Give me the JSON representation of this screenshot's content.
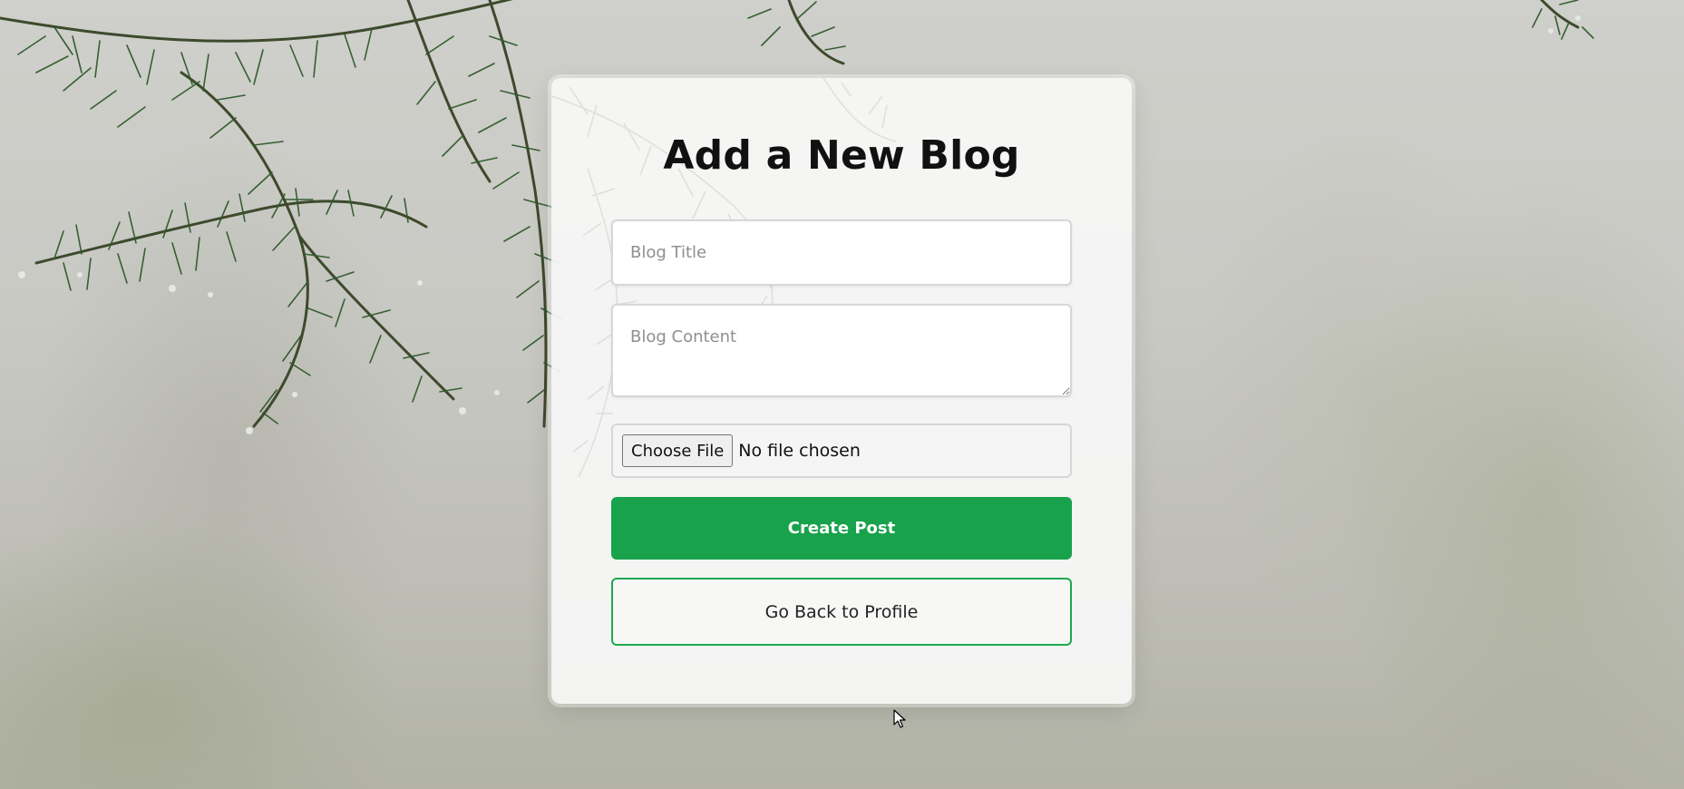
{
  "page": {
    "heading": "Add a New Blog"
  },
  "form": {
    "title_placeholder": "Blog Title",
    "title_value": "",
    "content_placeholder": "Blog Content",
    "content_value": "",
    "file_button_label": "Choose File",
    "file_status": "No file chosen",
    "create_label": "Create Post",
    "back_label": "Go Back to Profile"
  },
  "colors": {
    "primary_green": "#18a24b",
    "outline_green": "#1fa84f",
    "card_background": "#f8f8f7",
    "heading_text": "#111111"
  },
  "icons": {
    "cursor": "mouse-pointer-icon",
    "resize": "resize-handle-icon"
  }
}
